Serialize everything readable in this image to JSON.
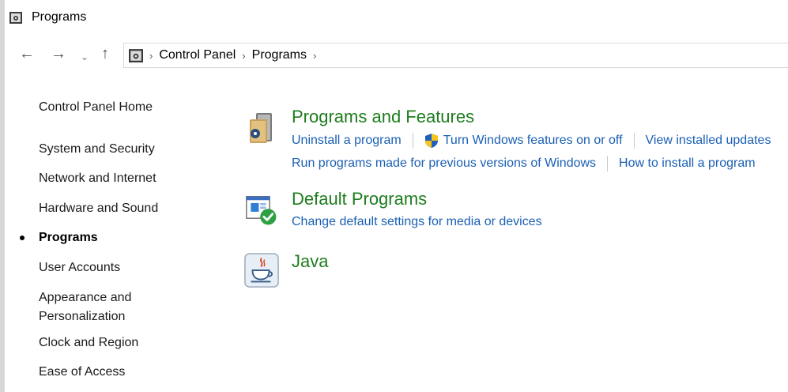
{
  "window": {
    "title": "Programs"
  },
  "nav": {
    "breadcrumbs": [
      "Control Panel",
      "Programs"
    ]
  },
  "leftnav": {
    "items": [
      {
        "label": "Control Panel Home",
        "active": false
      },
      {
        "label": "System and Security",
        "active": false
      },
      {
        "label": "Network and Internet",
        "active": false
      },
      {
        "label": "Hardware and Sound",
        "active": false
      },
      {
        "label": "Programs",
        "active": true
      },
      {
        "label": "User Accounts",
        "active": false
      },
      {
        "label": "Appearance and",
        "label2": "Personalization",
        "active": false
      },
      {
        "label": "Clock and Region",
        "active": false
      },
      {
        "label": "Ease of Access",
        "active": false
      }
    ]
  },
  "sections": {
    "programs_features": {
      "title": "Programs and Features",
      "links": {
        "uninstall": "Uninstall a program",
        "windows_features": "Turn Windows features on or off",
        "installed_updates": "View installed updates",
        "compat": "Run programs made for previous versions of Windows",
        "how_install": "How to install a program"
      }
    },
    "default_programs": {
      "title": "Default Programs",
      "links": {
        "change_defaults": "Change default settings for media or devices"
      }
    },
    "java": {
      "title": "Java"
    }
  },
  "colors": {
    "title_green": "#1e7d1e",
    "link_blue": "#1a5fb4"
  }
}
